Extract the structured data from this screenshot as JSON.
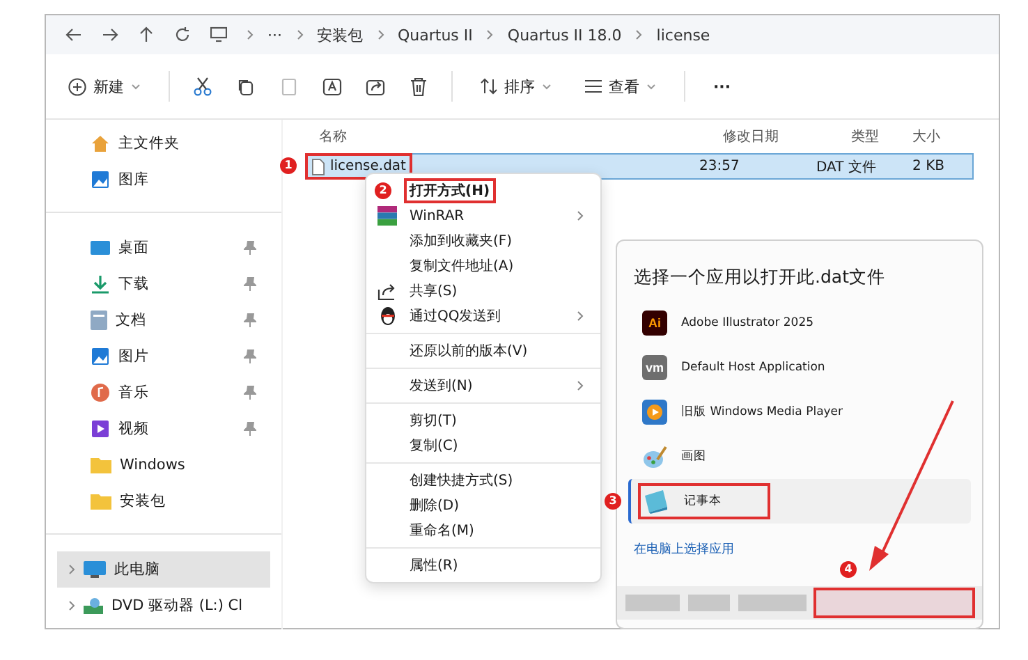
{
  "breadcrumb": [
    "···",
    "安装包",
    "Quartus II",
    "Quartus II 18.0",
    "license"
  ],
  "toolbar": {
    "new_label": "新建",
    "sort_label": "排序",
    "view_label": "查看",
    "more": "···"
  },
  "columns": [
    "名称",
    "修改日期",
    "类型",
    "大小"
  ],
  "files": [
    {
      "name": "license.dat",
      "modified": "23:57",
      "type": "DAT 文件",
      "size": "2 KB",
      "selected": true,
      "highlighted": true,
      "step": "1"
    }
  ],
  "sidebar": [
    [
      {
        "label": "主文件夹",
        "kind": "home",
        "pinned": false,
        "expandable": false,
        "selected": false
      },
      {
        "label": "图库",
        "kind": "gallery",
        "pinned": false,
        "expandable": false,
        "selected": false
      }
    ],
    [
      {
        "label": "桌面",
        "kind": "desktop",
        "pinned": true,
        "expandable": false,
        "selected": false
      },
      {
        "label": "下载",
        "kind": "download",
        "pinned": true,
        "expandable": false,
        "selected": false
      },
      {
        "label": "文档",
        "kind": "docs",
        "pinned": true,
        "expandable": false,
        "selected": false
      },
      {
        "label": "图片",
        "kind": "pictures",
        "pinned": true,
        "expandable": false,
        "selected": false
      },
      {
        "label": "音乐",
        "kind": "music",
        "pinned": true,
        "expandable": false,
        "selected": false
      },
      {
        "label": "视频",
        "kind": "video",
        "pinned": true,
        "expandable": false,
        "selected": false
      },
      {
        "label": "Windows",
        "kind": "folder",
        "pinned": false,
        "expandable": false,
        "selected": false
      },
      {
        "label": "安装包",
        "kind": "folder",
        "pinned": false,
        "expandable": false,
        "selected": false
      }
    ],
    [
      {
        "label": "此电脑",
        "kind": "pc",
        "pinned": false,
        "expandable": true,
        "selected": true
      },
      {
        "label": "DVD 驱动器 (L:) Cl",
        "kind": "dvd",
        "pinned": false,
        "expandable": true,
        "selected": false
      }
    ]
  ],
  "context_menu": [
    [
      {
        "label": "打开方式(H)",
        "kind": "plain",
        "submenu": false,
        "default": true,
        "highlighted": true,
        "step": "2"
      },
      {
        "label": "WinRAR",
        "kind": "winrar",
        "submenu": true,
        "default": false,
        "highlighted": false
      },
      {
        "label": "添加到收藏夹(F)",
        "kind": "plain",
        "submenu": false,
        "default": false,
        "highlighted": false
      },
      {
        "label": "复制文件地址(A)",
        "kind": "plain",
        "submenu": false,
        "default": false,
        "highlighted": false
      },
      {
        "label": "共享(S)",
        "kind": "share",
        "submenu": false,
        "default": false,
        "highlighted": false
      },
      {
        "label": "通过QQ发送到",
        "kind": "qq",
        "submenu": true,
        "default": false,
        "highlighted": false
      }
    ],
    [
      {
        "label": "还原以前的版本(V)",
        "kind": "plain",
        "submenu": false,
        "default": false,
        "highlighted": false
      }
    ],
    [
      {
        "label": "发送到(N)",
        "kind": "plain",
        "submenu": true,
        "default": false,
        "highlighted": false
      }
    ],
    [
      {
        "label": "剪切(T)",
        "kind": "plain",
        "submenu": false,
        "default": false,
        "highlighted": false
      },
      {
        "label": "复制(C)",
        "kind": "plain",
        "submenu": false,
        "default": false,
        "highlighted": false
      }
    ],
    [
      {
        "label": "创建快捷方式(S)",
        "kind": "plain",
        "submenu": false,
        "default": false,
        "highlighted": false
      },
      {
        "label": "删除(D)",
        "kind": "plain",
        "submenu": false,
        "default": false,
        "highlighted": false
      },
      {
        "label": "重命名(M)",
        "kind": "plain",
        "submenu": false,
        "default": false,
        "highlighted": false
      }
    ],
    [
      {
        "label": "属性(R)",
        "kind": "plain",
        "submenu": false,
        "default": false,
        "highlighted": false
      }
    ]
  ],
  "open_with": {
    "title": "选择一个应用以打开此.dat文件",
    "apps": [
      {
        "name": "Adobe Illustrator 2025",
        "kind": "logo",
        "logo_text": "Ai",
        "selected": false,
        "highlighted": false
      },
      {
        "name": "Default Host Application",
        "kind": "logo",
        "logo_text": "vm",
        "selected": false,
        "highlighted": false
      },
      {
        "name": "旧版 Windows Media Player",
        "kind": "player",
        "selected": false,
        "highlighted": false
      },
      {
        "name": "画图",
        "kind": "paint",
        "selected": false,
        "highlighted": false
      },
      {
        "name": "记事本",
        "kind": "notepad",
        "selected": true,
        "highlighted": true,
        "step": "3"
      }
    ],
    "link": "在电脑上选择应用",
    "footer": {
      "highlighted": true,
      "step": "4"
    }
  },
  "annotation_arrow": true
}
